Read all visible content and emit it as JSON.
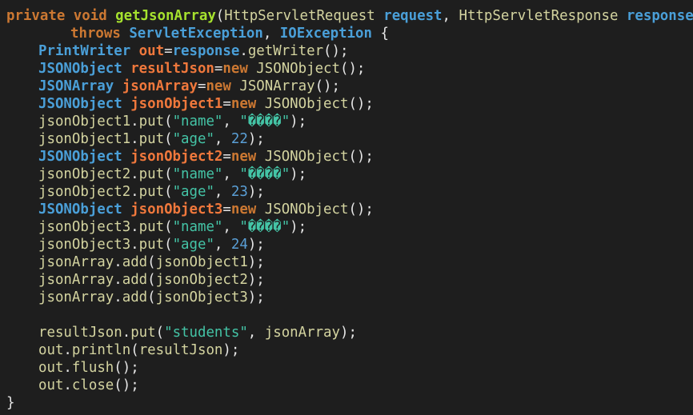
{
  "colors": {
    "background": "#1e1e1e",
    "keyword": "#cc7832",
    "method": "#a6e22e",
    "type": "#4a9fd8",
    "variable": "#f0783c",
    "plain": "#d4d4a0",
    "string": "#44c4a6",
    "number": "#5a9fd6",
    "punct": "#e6e6e6"
  },
  "code": {
    "lines": [
      {
        "indent": 0,
        "tokens": [
          {
            "t": "private",
            "c": "keyword"
          },
          {
            "t": " ",
            "c": "plain"
          },
          {
            "t": "void",
            "c": "keyword"
          },
          {
            "t": " ",
            "c": "plain"
          },
          {
            "t": "getJsonArray",
            "c": "method"
          },
          {
            "t": "(",
            "c": "punct"
          },
          {
            "t": "HttpServletRequest",
            "c": "plain"
          },
          {
            "t": " ",
            "c": "plain"
          },
          {
            "t": "request",
            "c": "type"
          },
          {
            "t": ", ",
            "c": "punct"
          },
          {
            "t": "HttpServletResponse",
            "c": "plain"
          },
          {
            "t": " ",
            "c": "plain"
          },
          {
            "t": "response",
            "c": "type"
          },
          {
            "t": ")",
            "c": "punct"
          }
        ]
      },
      {
        "indent": 2,
        "tokens": [
          {
            "t": "throws",
            "c": "keyword"
          },
          {
            "t": " ",
            "c": "plain"
          },
          {
            "t": "ServletException",
            "c": "type"
          },
          {
            "t": ", ",
            "c": "punct"
          },
          {
            "t": "IOException",
            "c": "type"
          },
          {
            "t": " {",
            "c": "punct"
          }
        ]
      },
      {
        "indent": 1,
        "tokens": [
          {
            "t": "PrintWriter",
            "c": "type"
          },
          {
            "t": " ",
            "c": "plain"
          },
          {
            "t": "out",
            "c": "variable"
          },
          {
            "t": "=",
            "c": "punct"
          },
          {
            "t": "response",
            "c": "type"
          },
          {
            "t": ".",
            "c": "punct"
          },
          {
            "t": "getWriter",
            "c": "plain"
          },
          {
            "t": "();",
            "c": "punct"
          }
        ]
      },
      {
        "indent": 1,
        "tokens": [
          {
            "t": "JSONObject",
            "c": "type"
          },
          {
            "t": " ",
            "c": "plain"
          },
          {
            "t": "resultJson",
            "c": "variable"
          },
          {
            "t": "=",
            "c": "punct"
          },
          {
            "t": "new",
            "c": "keyword"
          },
          {
            "t": " ",
            "c": "plain"
          },
          {
            "t": "JSONObject",
            "c": "plain"
          },
          {
            "t": "();",
            "c": "punct"
          }
        ]
      },
      {
        "indent": 1,
        "tokens": [
          {
            "t": "JSONArray",
            "c": "type"
          },
          {
            "t": " ",
            "c": "plain"
          },
          {
            "t": "jsonArray",
            "c": "variable"
          },
          {
            "t": "=",
            "c": "punct"
          },
          {
            "t": "new",
            "c": "keyword"
          },
          {
            "t": " ",
            "c": "plain"
          },
          {
            "t": "JSONArray",
            "c": "plain"
          },
          {
            "t": "();",
            "c": "punct"
          }
        ]
      },
      {
        "indent": 1,
        "tokens": [
          {
            "t": "JSONObject",
            "c": "type"
          },
          {
            "t": " ",
            "c": "plain"
          },
          {
            "t": "jsonObject1",
            "c": "variable"
          },
          {
            "t": "=",
            "c": "punct"
          },
          {
            "t": "new",
            "c": "keyword"
          },
          {
            "t": " ",
            "c": "plain"
          },
          {
            "t": "JSONObject",
            "c": "plain"
          },
          {
            "t": "();",
            "c": "punct"
          }
        ]
      },
      {
        "indent": 1,
        "tokens": [
          {
            "t": "jsonObject1",
            "c": "plain"
          },
          {
            "t": ".",
            "c": "punct"
          },
          {
            "t": "put",
            "c": "plain"
          },
          {
            "t": "(",
            "c": "punct"
          },
          {
            "t": "\"name\"",
            "c": "string"
          },
          {
            "t": ", ",
            "c": "punct"
          },
          {
            "t": "\"����\"",
            "c": "string"
          },
          {
            "t": ");",
            "c": "punct"
          }
        ]
      },
      {
        "indent": 1,
        "tokens": [
          {
            "t": "jsonObject1",
            "c": "plain"
          },
          {
            "t": ".",
            "c": "punct"
          },
          {
            "t": "put",
            "c": "plain"
          },
          {
            "t": "(",
            "c": "punct"
          },
          {
            "t": "\"age\"",
            "c": "string"
          },
          {
            "t": ", ",
            "c": "punct"
          },
          {
            "t": "22",
            "c": "number"
          },
          {
            "t": ");",
            "c": "punct"
          }
        ]
      },
      {
        "indent": 1,
        "tokens": [
          {
            "t": "JSONObject",
            "c": "type"
          },
          {
            "t": " ",
            "c": "plain"
          },
          {
            "t": "jsonObject2",
            "c": "variable"
          },
          {
            "t": "=",
            "c": "punct"
          },
          {
            "t": "new",
            "c": "keyword"
          },
          {
            "t": " ",
            "c": "plain"
          },
          {
            "t": "JSONObject",
            "c": "plain"
          },
          {
            "t": "();",
            "c": "punct"
          }
        ]
      },
      {
        "indent": 1,
        "tokens": [
          {
            "t": "jsonObject2",
            "c": "plain"
          },
          {
            "t": ".",
            "c": "punct"
          },
          {
            "t": "put",
            "c": "plain"
          },
          {
            "t": "(",
            "c": "punct"
          },
          {
            "t": "\"name\"",
            "c": "string"
          },
          {
            "t": ", ",
            "c": "punct"
          },
          {
            "t": "\"����\"",
            "c": "string"
          },
          {
            "t": ");",
            "c": "punct"
          }
        ]
      },
      {
        "indent": 1,
        "tokens": [
          {
            "t": "jsonObject2",
            "c": "plain"
          },
          {
            "t": ".",
            "c": "punct"
          },
          {
            "t": "put",
            "c": "plain"
          },
          {
            "t": "(",
            "c": "punct"
          },
          {
            "t": "\"age\"",
            "c": "string"
          },
          {
            "t": ", ",
            "c": "punct"
          },
          {
            "t": "23",
            "c": "number"
          },
          {
            "t": ");",
            "c": "punct"
          }
        ]
      },
      {
        "indent": 1,
        "tokens": [
          {
            "t": "JSONObject",
            "c": "type"
          },
          {
            "t": " ",
            "c": "plain"
          },
          {
            "t": "jsonObject3",
            "c": "variable"
          },
          {
            "t": "=",
            "c": "punct"
          },
          {
            "t": "new",
            "c": "keyword"
          },
          {
            "t": " ",
            "c": "plain"
          },
          {
            "t": "JSONObject",
            "c": "plain"
          },
          {
            "t": "();",
            "c": "punct"
          }
        ]
      },
      {
        "indent": 1,
        "tokens": [
          {
            "t": "jsonObject3",
            "c": "plain"
          },
          {
            "t": ".",
            "c": "punct"
          },
          {
            "t": "put",
            "c": "plain"
          },
          {
            "t": "(",
            "c": "punct"
          },
          {
            "t": "\"name\"",
            "c": "string"
          },
          {
            "t": ", ",
            "c": "punct"
          },
          {
            "t": "\"����\"",
            "c": "string"
          },
          {
            "t": ");",
            "c": "punct"
          }
        ]
      },
      {
        "indent": 1,
        "tokens": [
          {
            "t": "jsonObject3",
            "c": "plain"
          },
          {
            "t": ".",
            "c": "punct"
          },
          {
            "t": "put",
            "c": "plain"
          },
          {
            "t": "(",
            "c": "punct"
          },
          {
            "t": "\"age\"",
            "c": "string"
          },
          {
            "t": ", ",
            "c": "punct"
          },
          {
            "t": "24",
            "c": "number"
          },
          {
            "t": ");",
            "c": "punct"
          }
        ]
      },
      {
        "indent": 1,
        "tokens": [
          {
            "t": "jsonArray",
            "c": "plain"
          },
          {
            "t": ".",
            "c": "punct"
          },
          {
            "t": "add",
            "c": "plain"
          },
          {
            "t": "(",
            "c": "punct"
          },
          {
            "t": "jsonObject1",
            "c": "plain"
          },
          {
            "t": ");",
            "c": "punct"
          }
        ]
      },
      {
        "indent": 1,
        "tokens": [
          {
            "t": "jsonArray",
            "c": "plain"
          },
          {
            "t": ".",
            "c": "punct"
          },
          {
            "t": "add",
            "c": "plain"
          },
          {
            "t": "(",
            "c": "punct"
          },
          {
            "t": "jsonObject2",
            "c": "plain"
          },
          {
            "t": ");",
            "c": "punct"
          }
        ]
      },
      {
        "indent": 1,
        "tokens": [
          {
            "t": "jsonArray",
            "c": "plain"
          },
          {
            "t": ".",
            "c": "punct"
          },
          {
            "t": "add",
            "c": "plain"
          },
          {
            "t": "(",
            "c": "punct"
          },
          {
            "t": "jsonObject3",
            "c": "plain"
          },
          {
            "t": ");",
            "c": "punct"
          }
        ]
      },
      {
        "indent": 0,
        "tokens": []
      },
      {
        "indent": 1,
        "tokens": [
          {
            "t": "resultJson",
            "c": "plain"
          },
          {
            "t": ".",
            "c": "punct"
          },
          {
            "t": "put",
            "c": "plain"
          },
          {
            "t": "(",
            "c": "punct"
          },
          {
            "t": "\"students\"",
            "c": "string"
          },
          {
            "t": ", ",
            "c": "punct"
          },
          {
            "t": "jsonArray",
            "c": "plain"
          },
          {
            "t": ");",
            "c": "punct"
          }
        ]
      },
      {
        "indent": 1,
        "tokens": [
          {
            "t": "out",
            "c": "plain"
          },
          {
            "t": ".",
            "c": "punct"
          },
          {
            "t": "println",
            "c": "plain"
          },
          {
            "t": "(",
            "c": "punct"
          },
          {
            "t": "resultJson",
            "c": "plain"
          },
          {
            "t": ");",
            "c": "punct"
          }
        ]
      },
      {
        "indent": 1,
        "tokens": [
          {
            "t": "out",
            "c": "plain"
          },
          {
            "t": ".",
            "c": "punct"
          },
          {
            "t": "flush",
            "c": "plain"
          },
          {
            "t": "();",
            "c": "punct"
          }
        ]
      },
      {
        "indent": 1,
        "tokens": [
          {
            "t": "out",
            "c": "plain"
          },
          {
            "t": ".",
            "c": "punct"
          },
          {
            "t": "close",
            "c": "plain"
          },
          {
            "t": "();",
            "c": "punct"
          }
        ]
      },
      {
        "indent": 0,
        "tokens": [
          {
            "t": "}",
            "c": "punct"
          }
        ]
      }
    ]
  }
}
